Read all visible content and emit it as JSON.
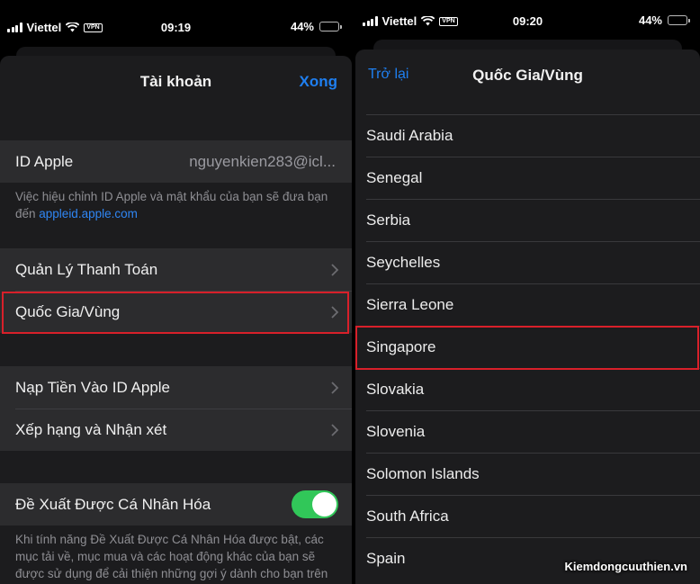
{
  "left": {
    "status": {
      "carrier": "Viettel",
      "vpn": "VPN",
      "time": "09:19",
      "battery": "44%"
    },
    "nav": {
      "title": "Tài khoản",
      "done": "Xong"
    },
    "apple_id": {
      "label": "ID Apple",
      "value": "nguyenkien283@icl..."
    },
    "apple_id_footer": {
      "text": "Việc hiệu chỉnh ID Apple và mật khẩu của bạn sẽ đưa bạn đến ",
      "link": "appleid.apple.com"
    },
    "payment": "Quản Lý Thanh Toán",
    "country": "Quốc Gia/Vùng",
    "add_funds": "Nạp Tiền Vào ID Apple",
    "ratings": "Xếp hạng và Nhận xét",
    "personalized": "Đề Xuất Được Cá Nhân Hóa",
    "personalized_footer": "Khi tính năng Đề Xuất Được Cá Nhân Hóa được bật, các mục tải về, mục mua và các hoạt động khác của bạn sẽ được sử dụng để cải thiện những gợi ý dành cho bạn trên iTunes Store, App Store và Apple Books."
  },
  "right": {
    "status": {
      "carrier": "Viettel",
      "vpn": "VPN",
      "time": "09:20",
      "battery": "44%"
    },
    "nav": {
      "back": "Trở lại",
      "title": "Quốc Gia/Vùng"
    },
    "countries": [
      "Saudi Arabia",
      "Senegal",
      "Serbia",
      "Seychelles",
      "Sierra Leone",
      "Singapore",
      "Slovakia",
      "Slovenia",
      "Solomon Islands",
      "South Africa",
      "Spain"
    ]
  },
  "watermark": "Kiemdongcuuthien.vn",
  "colors": {
    "accent": "#1f7ff0",
    "highlight": "#d8202a",
    "toggle_on": "#31c759"
  }
}
